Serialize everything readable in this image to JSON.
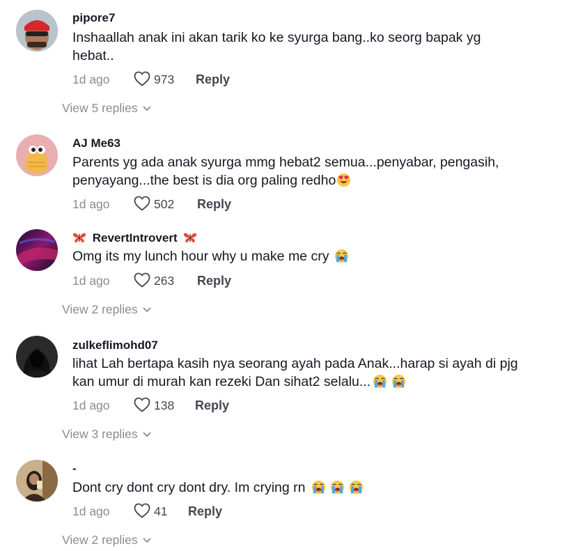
{
  "comments": [
    {
      "username": "pipore7",
      "text": "Inshaallah anak ini akan tarik ko ke syurga bang..ko seorg bapak yg hebat..",
      "time": "1d ago",
      "likes": "973",
      "reply_label": "Reply",
      "view_replies": "View 5 replies"
    },
    {
      "username": "AJ Me63",
      "text": "Parents yg ada anak syurga mmg hebat2 semua...penyabar, pengasih, penyayang...the best is dia org paling redho",
      "emoji": "heart-eyes-emoji",
      "time": "1d ago",
      "likes": "502",
      "reply_label": "Reply"
    },
    {
      "username": "RevertIntrovert",
      "username_decoration": "butterfly-emoji",
      "text": "Omg its my lunch hour why u make me cry",
      "emoji": "loudly-crying-emoji",
      "time": "1d ago",
      "likes": "263",
      "reply_label": "Reply",
      "view_replies": "View 2 replies"
    },
    {
      "username": "zulkeflimohd07",
      "text": "lihat Lah bertapa kasih nya seorang ayah pada Anak...harap si ayah di pjg kan umur di murah kan rezeki Dan sihat2 selalu...",
      "emoji": "loudly-crying-emoji",
      "time": "1d ago",
      "likes": "138",
      "reply_label": "Reply",
      "view_replies": "View 3 replies"
    },
    {
      "username": "-",
      "text": "Dont cry dont cry dont dry. Im crying rn",
      "emoji": "loudly-crying-emoji",
      "time": "1d ago",
      "likes": "41",
      "reply_label": "Reply",
      "view_replies": "View 2 replies"
    }
  ],
  "icons": {
    "like": "heart-outline-icon",
    "expand": "chevron-down-icon"
  },
  "colors": {
    "text": "#161823",
    "secondary": "#8a8b91",
    "action": "#454650"
  }
}
